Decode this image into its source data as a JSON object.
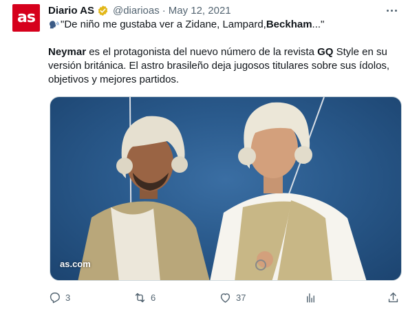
{
  "account": {
    "avatar_text": "as",
    "display_name": "Diario AS",
    "handle": "@diarioas",
    "separator": "·",
    "date": "May 12, 2021",
    "verified_icon": "verified-gold-badge-icon",
    "brand_color": "#d6001c"
  },
  "tweet": {
    "quote_open": "\"De niño me gustaba ver a Zidane, Lampard, ",
    "quote_bold": "Beckham",
    "quote_close": "...\"",
    "para_bold1": "Neymar",
    "para_text1": " es el protagonista del nuevo número de la revista ",
    "para_bold2": "GQ",
    "para_text2": " Style en su versión británica. El astro brasileño deja jugosos titulares sobre sus ídolos, objetivos y mejores partidos."
  },
  "media": {
    "watermark": "as.com"
  },
  "actions": {
    "reply_count": "3",
    "retweet_count": "6",
    "like_count": "37"
  }
}
